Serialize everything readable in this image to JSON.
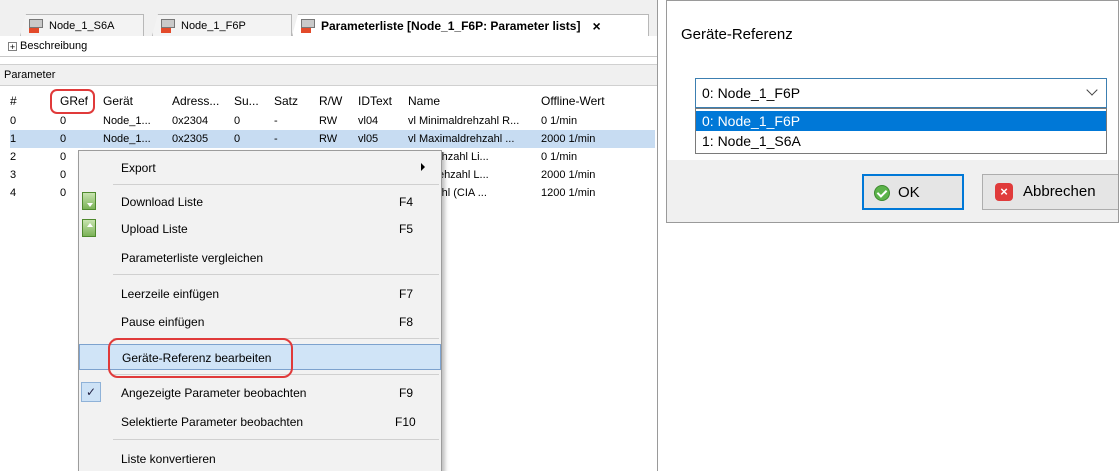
{
  "tabs": [
    {
      "label": "Node_1_S6A"
    },
    {
      "label": "Node_1_F6P"
    },
    {
      "label": "Parameterliste [Node_1_F6P: Parameter lists]"
    }
  ],
  "description_label": "Beschreibung",
  "parameters_label": "Parameter",
  "table": {
    "headers": [
      "#",
      "GRef",
      "Gerät",
      "Adress...",
      "Su...",
      "Satz",
      "R/W",
      "IDText",
      "Name",
      "Offline-Wert"
    ],
    "rows": [
      [
        "0",
        "0",
        "Node_1...",
        "0x2304",
        "0",
        "-",
        "RW",
        "vl04",
        "vl Minimaldrehzahl R...",
        "0 1/min"
      ],
      [
        "1",
        "0",
        "Node_1...",
        "0x2305",
        "0",
        "-",
        "RW",
        "vl05",
        "vl Maximaldrehzahl ...",
        "2000 1/min"
      ],
      [
        "2",
        "0",
        "",
        "",
        "",
        "",
        "",
        "",
        "maldrehzahl Li...",
        "0 1/min"
      ],
      [
        "3",
        "0",
        "",
        "",
        "",
        "",
        "",
        "",
        "imaldrehzahl L...",
        "2000 1/min"
      ],
      [
        "4",
        "0",
        "",
        "",
        "",
        "",
        "",
        "",
        "drehzahl (CIA ...",
        "1200 1/min"
      ]
    ]
  },
  "context_menu": {
    "export": "Export",
    "download": "Download Liste",
    "download_sc": "F4",
    "upload": "Upload Liste",
    "upload_sc": "F5",
    "compare": "Parameterliste vergleichen",
    "insert_blank": "Leerzeile einfügen",
    "insert_blank_sc": "F7",
    "insert_pause": "Pause einfügen",
    "insert_pause_sc": "F8",
    "edit_device_ref": "Geräte-Referenz bearbeiten",
    "watch_displayed": "Angezeigte Parameter beobachten",
    "watch_displayed_sc": "F9",
    "watch_selected": "Selektierte Parameter beobachten",
    "watch_selected_sc": "F10",
    "convert": "Liste konvertieren"
  },
  "dialog": {
    "title": "Geräte-Referenz",
    "selected_value": "0: Node_1_F6P",
    "options": [
      "0: Node_1_F6P",
      "1: Node_1_S6A"
    ],
    "ok_label": "OK",
    "cancel_label": "Abbrechen"
  },
  "colors": {
    "accent": "#0078d7",
    "highlight_circle": "#e03a3a",
    "row_selected": "#c7dcf2"
  }
}
